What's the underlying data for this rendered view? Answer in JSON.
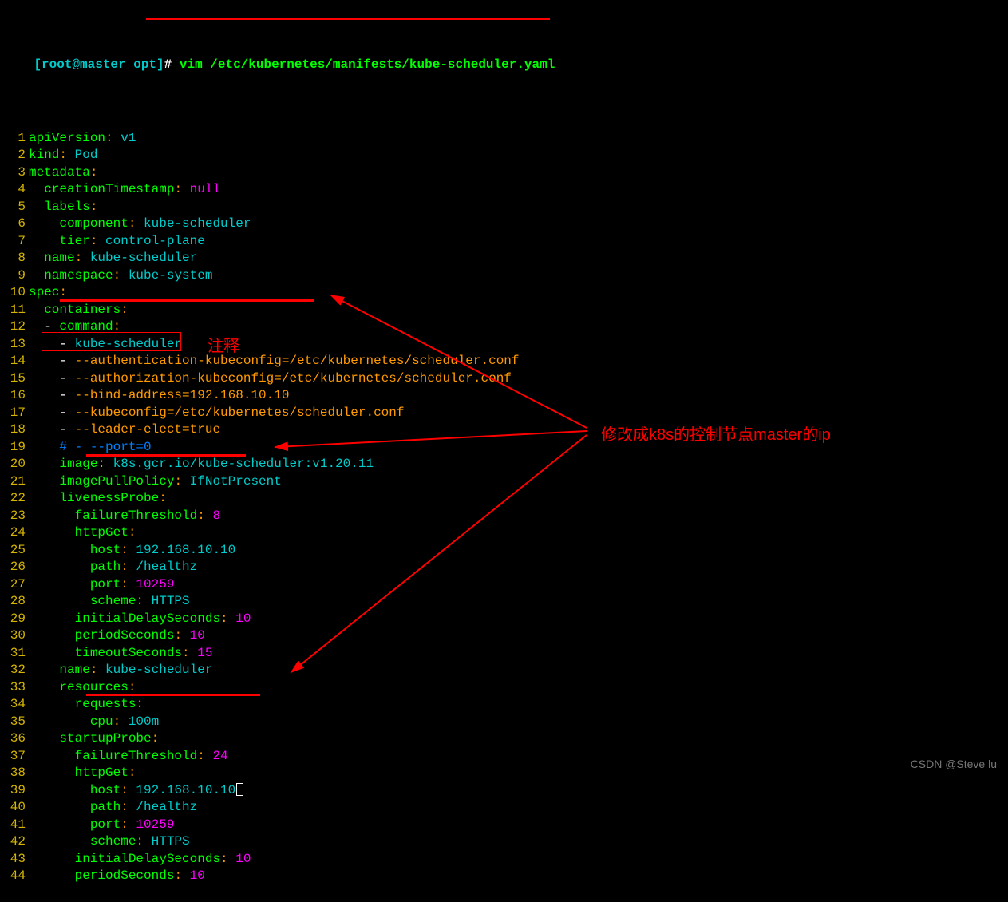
{
  "prompt": {
    "user_host": "[root@master opt]",
    "hash": "#",
    "command": "vim /etc/kubernetes/manifests/kube-scheduler.yaml"
  },
  "code": [
    {
      "n": "1",
      "tokens": [
        [
          "key",
          "apiVersion"
        ],
        [
          "col",
          ": "
        ],
        [
          "str",
          "v1"
        ]
      ]
    },
    {
      "n": "2",
      "tokens": [
        [
          "key",
          "kind"
        ],
        [
          "col",
          ": "
        ],
        [
          "str",
          "Pod"
        ]
      ]
    },
    {
      "n": "3",
      "tokens": [
        [
          "key",
          "metadata"
        ],
        [
          "col",
          ":"
        ]
      ]
    },
    {
      "n": "4",
      "indent": "  ",
      "tokens": [
        [
          "key",
          "creationTimestamp"
        ],
        [
          "col",
          ": "
        ],
        [
          "null",
          "null"
        ]
      ]
    },
    {
      "n": "5",
      "indent": "  ",
      "tokens": [
        [
          "key",
          "labels"
        ],
        [
          "col",
          ":"
        ]
      ]
    },
    {
      "n": "6",
      "indent": "    ",
      "tokens": [
        [
          "key",
          "component"
        ],
        [
          "col",
          ": "
        ],
        [
          "str",
          "kube-scheduler"
        ]
      ]
    },
    {
      "n": "7",
      "indent": "    ",
      "tokens": [
        [
          "key",
          "tier"
        ],
        [
          "col",
          ": "
        ],
        [
          "str",
          "control-plane"
        ]
      ]
    },
    {
      "n": "8",
      "indent": "  ",
      "tokens": [
        [
          "key",
          "name"
        ],
        [
          "col",
          ": "
        ],
        [
          "str",
          "kube-scheduler"
        ]
      ]
    },
    {
      "n": "9",
      "indent": "  ",
      "tokens": [
        [
          "key",
          "namespace"
        ],
        [
          "col",
          ": "
        ],
        [
          "str",
          "kube-system"
        ]
      ]
    },
    {
      "n": "10",
      "tokens": [
        [
          "key",
          "spec"
        ],
        [
          "col",
          ":"
        ]
      ]
    },
    {
      "n": "11",
      "indent": "  ",
      "tokens": [
        [
          "key",
          "containers"
        ],
        [
          "col",
          ":"
        ]
      ]
    },
    {
      "n": "12",
      "indent": "  ",
      "tokens": [
        [
          "dash",
          "- "
        ],
        [
          "key",
          "command"
        ],
        [
          "col",
          ":"
        ]
      ]
    },
    {
      "n": "13",
      "indent": "    ",
      "tokens": [
        [
          "dash",
          "- "
        ],
        [
          "str",
          "kube-scheduler"
        ]
      ]
    },
    {
      "n": "14",
      "indent": "    ",
      "tokens": [
        [
          "dash",
          "- "
        ],
        [
          "arg",
          "--authentication-kubeconfig=/etc/kubernetes/scheduler.conf"
        ]
      ]
    },
    {
      "n": "15",
      "indent": "    ",
      "tokens": [
        [
          "dash",
          "- "
        ],
        [
          "arg",
          "--authorization-kubeconfig=/etc/kubernetes/scheduler.conf"
        ]
      ]
    },
    {
      "n": "16",
      "indent": "    ",
      "tokens": [
        [
          "dash",
          "- "
        ],
        [
          "arg",
          "--bind-address=192.168.10.10"
        ]
      ]
    },
    {
      "n": "17",
      "indent": "    ",
      "tokens": [
        [
          "dash",
          "- "
        ],
        [
          "arg",
          "--kubeconfig=/etc/kubernetes/scheduler.conf"
        ]
      ]
    },
    {
      "n": "18",
      "indent": "    ",
      "tokens": [
        [
          "dash",
          "- "
        ],
        [
          "arg",
          "--leader-elect=true"
        ]
      ]
    },
    {
      "n": "19",
      "indent": "    ",
      "tokens": [
        [
          "cmt",
          "# - --port=0"
        ]
      ]
    },
    {
      "n": "20",
      "indent": "    ",
      "tokens": [
        [
          "key",
          "image"
        ],
        [
          "col",
          ": "
        ],
        [
          "str",
          "k8s.gcr.io/kube-scheduler:v1.20.11"
        ]
      ]
    },
    {
      "n": "21",
      "indent": "    ",
      "tokens": [
        [
          "key",
          "imagePullPolicy"
        ],
        [
          "col",
          ": "
        ],
        [
          "str",
          "IfNotPresent"
        ]
      ]
    },
    {
      "n": "22",
      "indent": "    ",
      "tokens": [
        [
          "key",
          "livenessProbe"
        ],
        [
          "col",
          ":"
        ]
      ]
    },
    {
      "n": "23",
      "indent": "      ",
      "tokens": [
        [
          "key",
          "failureThreshold"
        ],
        [
          "col",
          ": "
        ],
        [
          "num",
          "8"
        ]
      ]
    },
    {
      "n": "24",
      "indent": "      ",
      "tokens": [
        [
          "key",
          "httpGet"
        ],
        [
          "col",
          ":"
        ]
      ]
    },
    {
      "n": "25",
      "indent": "        ",
      "tokens": [
        [
          "key",
          "host"
        ],
        [
          "col",
          ": "
        ],
        [
          "str",
          "192.168.10.10"
        ]
      ]
    },
    {
      "n": "26",
      "indent": "        ",
      "tokens": [
        [
          "key",
          "path"
        ],
        [
          "col",
          ": "
        ],
        [
          "str",
          "/healthz"
        ]
      ]
    },
    {
      "n": "27",
      "indent": "        ",
      "tokens": [
        [
          "key",
          "port"
        ],
        [
          "col",
          ": "
        ],
        [
          "num",
          "10259"
        ]
      ]
    },
    {
      "n": "28",
      "indent": "        ",
      "tokens": [
        [
          "key",
          "scheme"
        ],
        [
          "col",
          ": "
        ],
        [
          "str",
          "HTTPS"
        ]
      ]
    },
    {
      "n": "29",
      "indent": "      ",
      "tokens": [
        [
          "key",
          "initialDelaySeconds"
        ],
        [
          "col",
          ": "
        ],
        [
          "num",
          "10"
        ]
      ]
    },
    {
      "n": "30",
      "indent": "      ",
      "tokens": [
        [
          "key",
          "periodSeconds"
        ],
        [
          "col",
          ": "
        ],
        [
          "num",
          "10"
        ]
      ]
    },
    {
      "n": "31",
      "indent": "      ",
      "tokens": [
        [
          "key",
          "timeoutSeconds"
        ],
        [
          "col",
          ": "
        ],
        [
          "num",
          "15"
        ]
      ]
    },
    {
      "n": "32",
      "indent": "    ",
      "tokens": [
        [
          "key",
          "name"
        ],
        [
          "col",
          ": "
        ],
        [
          "str",
          "kube-scheduler"
        ]
      ]
    },
    {
      "n": "33",
      "indent": "    ",
      "tokens": [
        [
          "key",
          "resources"
        ],
        [
          "col",
          ":"
        ]
      ]
    },
    {
      "n": "34",
      "indent": "      ",
      "tokens": [
        [
          "key",
          "requests"
        ],
        [
          "col",
          ":"
        ]
      ]
    },
    {
      "n": "35",
      "indent": "        ",
      "tokens": [
        [
          "key",
          "cpu"
        ],
        [
          "col",
          ": "
        ],
        [
          "str",
          "100m"
        ]
      ]
    },
    {
      "n": "36",
      "indent": "    ",
      "tokens": [
        [
          "key",
          "startupProbe"
        ],
        [
          "col",
          ":"
        ]
      ]
    },
    {
      "n": "37",
      "indent": "      ",
      "tokens": [
        [
          "key",
          "failureThreshold"
        ],
        [
          "col",
          ": "
        ],
        [
          "num",
          "24"
        ]
      ]
    },
    {
      "n": "38",
      "indent": "      ",
      "tokens": [
        [
          "key",
          "httpGet"
        ],
        [
          "col",
          ":"
        ]
      ]
    },
    {
      "n": "39",
      "indent": "        ",
      "tokens": [
        [
          "key",
          "host"
        ],
        [
          "col",
          ": "
        ],
        [
          "str",
          "192.168.10.10"
        ],
        [
          "cursor",
          ""
        ]
      ]
    },
    {
      "n": "40",
      "indent": "        ",
      "tokens": [
        [
          "key",
          "path"
        ],
        [
          "col",
          ": "
        ],
        [
          "str",
          "/healthz"
        ]
      ]
    },
    {
      "n": "41",
      "indent": "        ",
      "tokens": [
        [
          "key",
          "port"
        ],
        [
          "col",
          ": "
        ],
        [
          "num",
          "10259"
        ]
      ]
    },
    {
      "n": "42",
      "indent": "        ",
      "tokens": [
        [
          "key",
          "scheme"
        ],
        [
          "col",
          ": "
        ],
        [
          "str",
          "HTTPS"
        ]
      ]
    },
    {
      "n": "43",
      "indent": "      ",
      "tokens": [
        [
          "key",
          "initialDelaySeconds"
        ],
        [
          "col",
          ": "
        ],
        [
          "num",
          "10"
        ]
      ]
    },
    {
      "n": "44",
      "indent": "      ",
      "tokens": [
        [
          "key",
          "periodSeconds"
        ],
        [
          "col",
          ": "
        ],
        [
          "num",
          "10"
        ]
      ]
    }
  ],
  "annotations": {
    "comment_label": "注释",
    "ip_label": "修改成k8s的控制节点master的ip"
  },
  "watermark": "CSDN @Steve lu"
}
